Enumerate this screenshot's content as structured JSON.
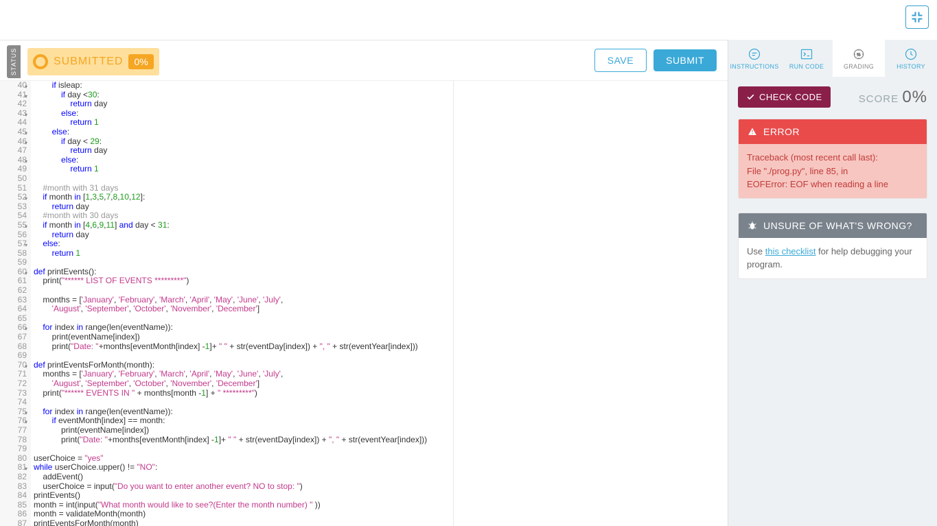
{
  "toolbar": {
    "status_label": "STATUS",
    "submitted_label": "SUBMITTED",
    "submitted_pct": "0%",
    "save_label": "SAVE",
    "submit_label": "SUBMIT"
  },
  "nav": {
    "instructions": "INSTRUCTIONS",
    "run_code": "RUN CODE",
    "grading": "GRADING",
    "history": "HISTORY"
  },
  "grading": {
    "check_code_label": "CHECK CODE",
    "score_label": "SCORE",
    "score_value": "0%"
  },
  "error_panel": {
    "title": "ERROR",
    "line1": "Traceback (most recent call last):",
    "line2": "File \"./prog.py\", line 85, in",
    "line3": "EOFError: EOF when reading a line"
  },
  "help_panel": {
    "title": "UNSURE OF WHAT'S WRONG?",
    "prefix": "Use ",
    "link": "this checklist",
    "suffix": " for help debugging your program."
  },
  "code": {
    "first_line": 40,
    "fold_lines": [
      40,
      41,
      43,
      45,
      46,
      48,
      52,
      55,
      57,
      60,
      66,
      70,
      75,
      76,
      81
    ],
    "lines": [
      [
        [
          "        ",
          null
        ],
        [
          "if",
          "kw"
        ],
        [
          " isleap:",
          null
        ]
      ],
      [
        [
          "            ",
          null
        ],
        [
          "if",
          "kw"
        ],
        [
          " day <",
          null
        ],
        [
          "30",
          "num"
        ],
        [
          ":",
          null
        ]
      ],
      [
        [
          "                ",
          null
        ],
        [
          "return",
          "kw"
        ],
        [
          " day",
          null
        ]
      ],
      [
        [
          "            ",
          null
        ],
        [
          "else",
          "kw"
        ],
        [
          ":",
          null
        ]
      ],
      [
        [
          "                ",
          null
        ],
        [
          "return",
          "kw"
        ],
        [
          " ",
          null
        ],
        [
          "1",
          "num"
        ]
      ],
      [
        [
          "        ",
          null
        ],
        [
          "else",
          "kw"
        ],
        [
          ":",
          null
        ]
      ],
      [
        [
          "            ",
          null
        ],
        [
          "if",
          "kw"
        ],
        [
          " day < ",
          null
        ],
        [
          "29",
          "num"
        ],
        [
          ":",
          null
        ]
      ],
      [
        [
          "                ",
          null
        ],
        [
          "return",
          "kw"
        ],
        [
          " day",
          null
        ]
      ],
      [
        [
          "            ",
          null
        ],
        [
          "else",
          "kw"
        ],
        [
          ":",
          null
        ]
      ],
      [
        [
          "                ",
          null
        ],
        [
          "return",
          "kw"
        ],
        [
          " ",
          null
        ],
        [
          "1",
          "num"
        ]
      ],
      [
        [
          "",
          null
        ]
      ],
      [
        [
          "    ",
          null
        ],
        [
          "#month with 31 days",
          "cmt"
        ]
      ],
      [
        [
          "    ",
          null
        ],
        [
          "if",
          "kw"
        ],
        [
          " month ",
          null
        ],
        [
          "in",
          "kw"
        ],
        [
          " [",
          null
        ],
        [
          "1",
          "num"
        ],
        [
          ",",
          null
        ],
        [
          "3",
          "num"
        ],
        [
          ",",
          null
        ],
        [
          "5",
          "num"
        ],
        [
          ",",
          null
        ],
        [
          "7",
          "num"
        ],
        [
          ",",
          null
        ],
        [
          "8",
          "num"
        ],
        [
          ",",
          null
        ],
        [
          "10",
          "num"
        ],
        [
          ",",
          null
        ],
        [
          "12",
          "num"
        ],
        [
          "]:",
          null
        ]
      ],
      [
        [
          "        ",
          null
        ],
        [
          "return",
          "kw"
        ],
        [
          " day",
          null
        ]
      ],
      [
        [
          "    ",
          null
        ],
        [
          "#month with 30 days",
          "cmt"
        ]
      ],
      [
        [
          "    ",
          null
        ],
        [
          "if",
          "kw"
        ],
        [
          " month ",
          null
        ],
        [
          "in",
          "kw"
        ],
        [
          " [",
          null
        ],
        [
          "4",
          "num"
        ],
        [
          ",",
          null
        ],
        [
          "6",
          "num"
        ],
        [
          ",",
          null
        ],
        [
          "9",
          "num"
        ],
        [
          ",",
          null
        ],
        [
          "11",
          "num"
        ],
        [
          "] ",
          null
        ],
        [
          "and",
          "kw"
        ],
        [
          " day < ",
          null
        ],
        [
          "31",
          "num"
        ],
        [
          ":",
          null
        ]
      ],
      [
        [
          "        ",
          null
        ],
        [
          "return",
          "kw"
        ],
        [
          " day",
          null
        ]
      ],
      [
        [
          "    ",
          null
        ],
        [
          "else",
          "kw"
        ],
        [
          ":",
          null
        ]
      ],
      [
        [
          "        ",
          null
        ],
        [
          "return",
          "kw"
        ],
        [
          " ",
          null
        ],
        [
          "1",
          "num"
        ]
      ],
      [
        [
          "",
          null
        ]
      ],
      [
        [
          "def",
          "kw"
        ],
        [
          " ",
          null
        ],
        [
          "printEvents",
          "fn"
        ],
        [
          "():",
          null
        ]
      ],
      [
        [
          "    ",
          null
        ],
        [
          "print",
          "fn"
        ],
        [
          "(",
          null
        ],
        [
          "\"****** LIST OF EVENTS *********\"",
          "str"
        ],
        [
          ")",
          null
        ]
      ],
      [
        [
          "",
          null
        ]
      ],
      [
        [
          "    months = [",
          null
        ],
        [
          "'January'",
          "str"
        ],
        [
          ", ",
          null
        ],
        [
          "'February'",
          "str"
        ],
        [
          ", ",
          null
        ],
        [
          "'March'",
          "str"
        ],
        [
          ", ",
          null
        ],
        [
          "'April'",
          "str"
        ],
        [
          ", ",
          null
        ],
        [
          "'May'",
          "str"
        ],
        [
          ", ",
          null
        ],
        [
          "'June'",
          "str"
        ],
        [
          ", ",
          null
        ],
        [
          "'July'",
          "str"
        ],
        [
          ",",
          null
        ]
      ],
      [
        [
          "        ",
          null
        ],
        [
          "'August'",
          "str"
        ],
        [
          ", ",
          null
        ],
        [
          "'September'",
          "str"
        ],
        [
          ", ",
          null
        ],
        [
          "'October'",
          "str"
        ],
        [
          ", ",
          null
        ],
        [
          "'November'",
          "str"
        ],
        [
          ", ",
          null
        ],
        [
          "'December'",
          "str"
        ],
        [
          "]",
          null
        ]
      ],
      [
        [
          "",
          null
        ]
      ],
      [
        [
          "    ",
          null
        ],
        [
          "for",
          "kw"
        ],
        [
          " index ",
          null
        ],
        [
          "in",
          "kw"
        ],
        [
          " ",
          null
        ],
        [
          "range",
          "fn"
        ],
        [
          "(",
          null
        ],
        [
          "len",
          "fn"
        ],
        [
          "(eventName)):",
          null
        ]
      ],
      [
        [
          "        ",
          null
        ],
        [
          "print",
          "fn"
        ],
        [
          "(eventName[index])",
          null
        ]
      ],
      [
        [
          "        ",
          null
        ],
        [
          "print",
          "fn"
        ],
        [
          "(",
          null
        ],
        [
          "\"Date: \"",
          "str"
        ],
        [
          "+months[eventMonth[index] -",
          null
        ],
        [
          "1",
          "num"
        ],
        [
          "]",
          null
        ],
        [
          "+ ",
          null
        ],
        [
          "\" \"",
          "str"
        ],
        [
          " + ",
          null
        ],
        [
          "str",
          "fn"
        ],
        [
          "(eventDay[index]) + ",
          null
        ],
        [
          "\", \"",
          "str"
        ],
        [
          " + ",
          null
        ],
        [
          "str",
          "fn"
        ],
        [
          "(eventYear[index]))",
          null
        ]
      ],
      [
        [
          "",
          null
        ]
      ],
      [
        [
          "def",
          "kw"
        ],
        [
          " ",
          null
        ],
        [
          "printEventsForMonth",
          "fn"
        ],
        [
          "(month):",
          null
        ]
      ],
      [
        [
          "    months = [",
          null
        ],
        [
          "'January'",
          "str"
        ],
        [
          ", ",
          null
        ],
        [
          "'February'",
          "str"
        ],
        [
          ", ",
          null
        ],
        [
          "'March'",
          "str"
        ],
        [
          ", ",
          null
        ],
        [
          "'April'",
          "str"
        ],
        [
          ", ",
          null
        ],
        [
          "'May'",
          "str"
        ],
        [
          ", ",
          null
        ],
        [
          "'June'",
          "str"
        ],
        [
          ", ",
          null
        ],
        [
          "'July'",
          "str"
        ],
        [
          ",",
          null
        ]
      ],
      [
        [
          "        ",
          null
        ],
        [
          "'August'",
          "str"
        ],
        [
          ", ",
          null
        ],
        [
          "'September'",
          "str"
        ],
        [
          ", ",
          null
        ],
        [
          "'October'",
          "str"
        ],
        [
          ", ",
          null
        ],
        [
          "'November'",
          "str"
        ],
        [
          ", ",
          null
        ],
        [
          "'December'",
          "str"
        ],
        [
          "]",
          null
        ]
      ],
      [
        [
          "    ",
          null
        ],
        [
          "print",
          "fn"
        ],
        [
          "(",
          null
        ],
        [
          "\"****** EVENTS IN \"",
          "str"
        ],
        [
          " + months[month -",
          null
        ],
        [
          "1",
          "num"
        ],
        [
          "] + ",
          null
        ],
        [
          "\" *********\"",
          "str"
        ],
        [
          ")",
          null
        ]
      ],
      [
        [
          "",
          null
        ]
      ],
      [
        [
          "    ",
          null
        ],
        [
          "for",
          "kw"
        ],
        [
          " index ",
          null
        ],
        [
          "in",
          "kw"
        ],
        [
          " ",
          null
        ],
        [
          "range",
          "fn"
        ],
        [
          "(",
          null
        ],
        [
          "len",
          "fn"
        ],
        [
          "(eventName)):",
          null
        ]
      ],
      [
        [
          "        ",
          null
        ],
        [
          "if",
          "kw"
        ],
        [
          " eventMonth[index] == month:",
          null
        ]
      ],
      [
        [
          "            ",
          null
        ],
        [
          "print",
          "fn"
        ],
        [
          "(eventName[index])",
          null
        ]
      ],
      [
        [
          "            ",
          null
        ],
        [
          "print",
          "fn"
        ],
        [
          "(",
          null
        ],
        [
          "\"Date: \"",
          "str"
        ],
        [
          "+months[eventMonth[index] -",
          null
        ],
        [
          "1",
          "num"
        ],
        [
          "]",
          null
        ],
        [
          "+ ",
          null
        ],
        [
          "\" \"",
          "str"
        ],
        [
          " + ",
          null
        ],
        [
          "str",
          "fn"
        ],
        [
          "(eventDay[index]) + ",
          null
        ],
        [
          "\", \"",
          "str"
        ],
        [
          " + ",
          null
        ],
        [
          "str",
          "fn"
        ],
        [
          "(eventYear[index]))",
          null
        ]
      ],
      [
        [
          "",
          null
        ]
      ],
      [
        [
          "userChoice = ",
          null
        ],
        [
          "\"yes\"",
          "str"
        ]
      ],
      [
        [
          "while",
          "kw"
        ],
        [
          " userChoice.upper() != ",
          null
        ],
        [
          "\"NO\"",
          "str"
        ],
        [
          ":",
          null
        ]
      ],
      [
        [
          "    addEvent()",
          null
        ]
      ],
      [
        [
          "    userChoice = ",
          null
        ],
        [
          "input",
          "fn"
        ],
        [
          "(",
          null
        ],
        [
          "\"Do you want to enter another event? NO to stop: \"",
          "str"
        ],
        [
          ")",
          null
        ]
      ],
      [
        [
          "printEvents()",
          null
        ]
      ],
      [
        [
          "month = ",
          null
        ],
        [
          "int",
          "fn"
        ],
        [
          "(",
          null
        ],
        [
          "input",
          "fn"
        ],
        [
          "(",
          null
        ],
        [
          "\"What month would like to see?(Enter the month number) \"",
          "str"
        ],
        [
          " ))",
          null
        ]
      ],
      [
        [
          "month = validateMonth(month)",
          null
        ]
      ],
      [
        [
          "printEventsForMonth(month)",
          null
        ]
      ]
    ]
  }
}
